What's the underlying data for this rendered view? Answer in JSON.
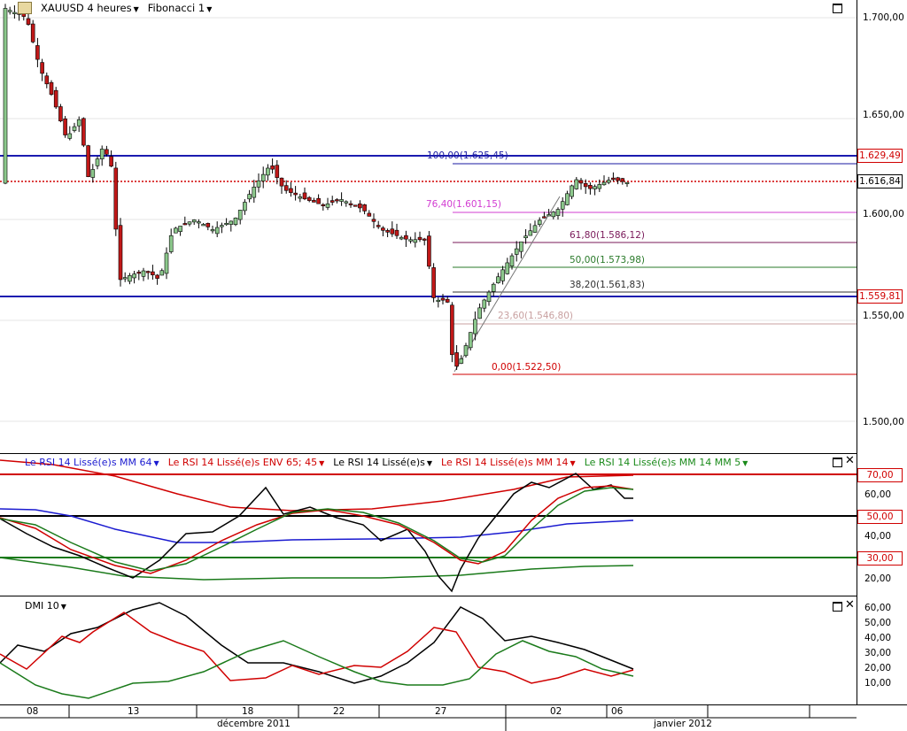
{
  "toolbar": {
    "symbol": "XAUUSD 4 heures",
    "study": "Fibonacci 1"
  },
  "price_axis": {
    "ticks": [
      {
        "label": "1.700,00"
      },
      {
        "label": "1.650,00"
      },
      {
        "label": "1.600,00"
      },
      {
        "label": "1.550,00"
      },
      {
        "label": "1.500,00"
      }
    ],
    "boxes": [
      {
        "label": "1.629,49",
        "color": "#d00000"
      },
      {
        "label": "1.616,84",
        "color": "#000000"
      },
      {
        "label": "1.559,81",
        "color": "#d00000"
      }
    ]
  },
  "fib_levels": [
    {
      "label": "100,00(1.625,45)",
      "color": "#1a1aa0"
    },
    {
      "label": "76,40(1.601,15)",
      "color": "#d23cd2"
    },
    {
      "label": "61,80(1.586,12)",
      "color": "#7a1a5a"
    },
    {
      "label": "50,00(1.573,98)",
      "color": "#2a7a2a"
    },
    {
      "label": "38,20(1.561,83)",
      "color": "#303030"
    },
    {
      "label": "23,60(1.546,80)",
      "color": "#c8a0a0"
    },
    {
      "label": "0,00(1.522,50)",
      "color": "#d00000"
    }
  ],
  "rsi_legend": [
    {
      "label": "Le RSI 14 Lissé(e)s MM 64",
      "color": "#1a1ad0"
    },
    {
      "label": "Le RSI 14 Lissé(e)s ENV 65; 45",
      "color": "#d00000"
    },
    {
      "label": "Le RSI 14 Lissé(e)s",
      "color": "#000000"
    },
    {
      "label": "Le RSI 14 Lissé(e)s MM 14",
      "color": "#d00000"
    },
    {
      "label": "Le RSI 14 Lissé(e)s MM 14 MM 5",
      "color": "#1a8a1a"
    }
  ],
  "rsi_axis": {
    "ticks": [
      {
        "label": "60,00"
      },
      {
        "label": "40,00"
      },
      {
        "label": "20,00"
      }
    ],
    "boxes": [
      {
        "label": "70,00",
        "color": "#d00000"
      },
      {
        "label": "50,00",
        "color": "#d00000"
      },
      {
        "label": "30,00",
        "color": "#d00000"
      }
    ]
  },
  "dmi": {
    "title": "DMI  10",
    "ticks": [
      {
        "label": "60,00"
      },
      {
        "label": "50,00"
      },
      {
        "label": "40,00"
      },
      {
        "label": "30,00"
      },
      {
        "label": "20,00"
      },
      {
        "label": "10,00"
      }
    ]
  },
  "x_axis": {
    "days": [
      {
        "label": "08"
      },
      {
        "label": "13"
      },
      {
        "label": "18"
      },
      {
        "label": "22"
      },
      {
        "label": "27"
      },
      {
        "label": "02"
      },
      {
        "label": "06"
      }
    ],
    "months": [
      {
        "label": "décembre 2011"
      },
      {
        "label": "janvier 2012"
      }
    ]
  },
  "colors": {
    "bull": "#8cc88c",
    "bear": "#c01818",
    "hline": "#1a1ab0",
    "close_line": "#d00000"
  }
}
